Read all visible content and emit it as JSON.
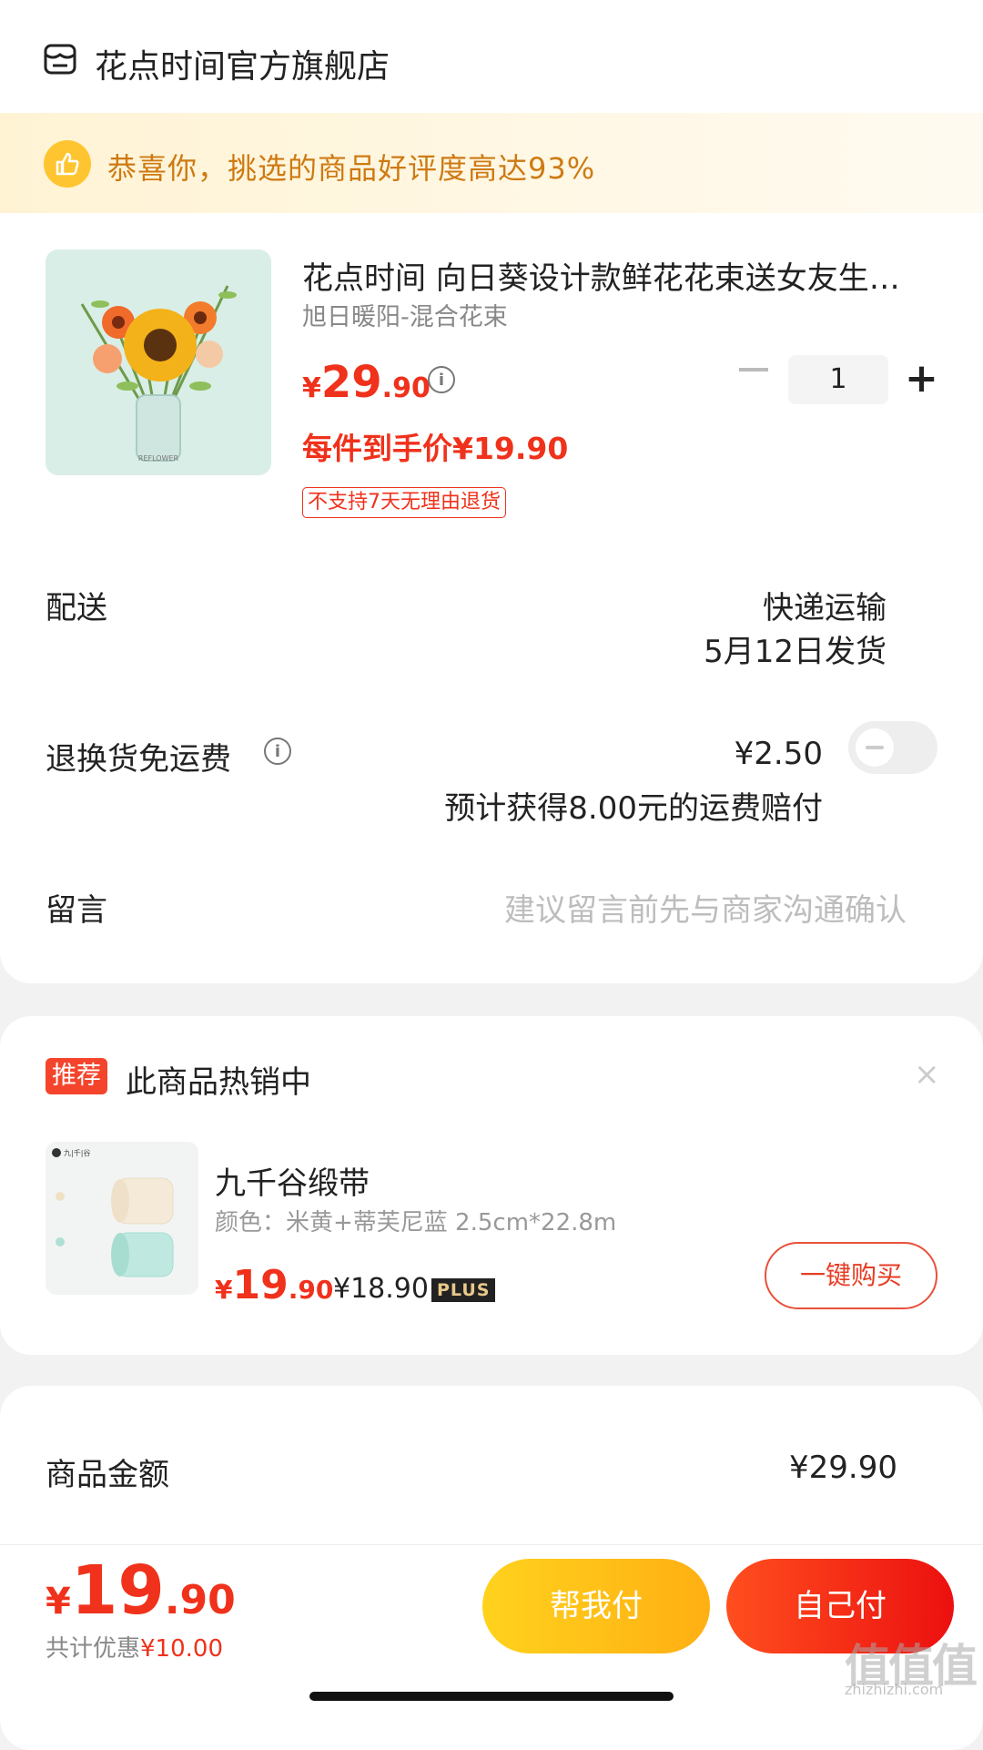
{
  "shop": {
    "name": "花点时间官方旗舰店",
    "icon": "shop-icon"
  },
  "banner": {
    "text": "恭喜你，挑选的商品好评度高达93%",
    "icon": "thumbs-up-icon"
  },
  "product": {
    "title": "花点时间 向日葵设计款鲜花花束送女友生…",
    "variant": "旭日暖阳-混合花束",
    "price": {
      "currency": "¥",
      "integer": "29",
      "decimal": ".90"
    },
    "deal_price": "每件到手价¥19.90",
    "return_tag": "不支持7天无理由退货",
    "quantity": "1"
  },
  "delivery": {
    "label": "配送",
    "method": "快递运输",
    "ship_date": "5月12日发货"
  },
  "return_insurance": {
    "label": "退换货免运费",
    "price": "¥2.50",
    "note": "预计获得8.00元的运费赔付",
    "enabled": false
  },
  "message": {
    "label": "留言",
    "placeholder": "建议留言前先与商家沟通确认"
  },
  "recommend": {
    "badge": "推荐",
    "title": "此商品热销中",
    "close": "×",
    "item": {
      "name": "九千谷缎带",
      "spec": "颜色：米黄+蒂芙尼蓝 2.5cm*22.8m",
      "price": {
        "currency": "¥",
        "integer": "19",
        "decimal": ".90"
      },
      "plus_price": "¥18.90",
      "plus_badge": "PLUS",
      "buy_label": "一键购买"
    }
  },
  "summary": {
    "label": "商品金额",
    "value": "¥29.90"
  },
  "footer": {
    "total": {
      "currency": "¥",
      "integer": "19",
      "decimal": ".90"
    },
    "saving_prefix": "共计优惠",
    "saving_value": "¥10.00",
    "help_pay": "帮我付",
    "self_pay": "自己付"
  },
  "watermark": {
    "text": "值值值",
    "url": "zhizhizhi.com"
  },
  "colors": {
    "accent": "#f0311b",
    "banner_text": "#ce7a12",
    "help_btn": "#ffc21a",
    "self_btn": "#f02d15"
  }
}
